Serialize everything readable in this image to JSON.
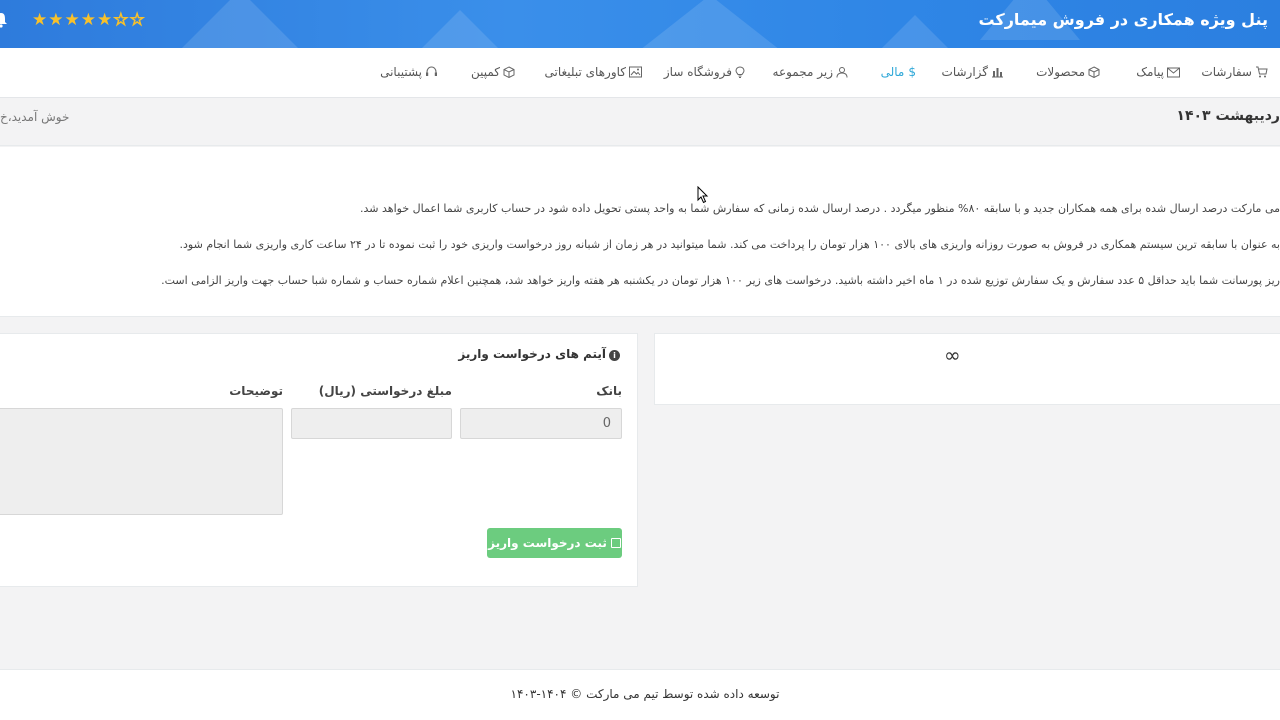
{
  "banner": {
    "title": "پنل ویژه همکاری در فروش میمارکت",
    "rating_filled": "★★★★★",
    "rating_empty": "☆☆"
  },
  "nav": {
    "items": [
      {
        "label": "سفارشات",
        "icon": "cart-icon"
      },
      {
        "label": "پیامک",
        "icon": "envelope-icon"
      },
      {
        "label": "محصولات",
        "icon": "box-icon"
      },
      {
        "label": "گزارشات",
        "icon": "bar-chart-icon"
      },
      {
        "label": "مالی",
        "icon": "dollar-icon"
      },
      {
        "label": "زیر مجموعه",
        "icon": "user-icon"
      },
      {
        "label": "فروشگاه ساز",
        "icon": "lightbulb-icon"
      },
      {
        "label": "کاورهای تبلیغاتی",
        "icon": "image-icon"
      },
      {
        "label": "کمپین",
        "icon": "box-icon"
      },
      {
        "label": "پشتیبانی",
        "icon": "headset-icon"
      }
    ],
    "active": "مالی"
  },
  "header": {
    "date": "ردیبهشت ۱۴۰۳",
    "welcome": "خوش آمدید،خ"
  },
  "notice": {
    "line1": "می مارکت درصد ارسال شده برای همه همکاران جدید و با سابقه ۸۰% منظور میگردد . درصد ارسال شده زمانی که سفارش شما به واحد پستی تحویل داده شود در حساب کاربری شما اعمال خواهد شد.",
    "line2": "به عنوان با سابقه ترین سیستم همکاری در فروش به صورت روزانه واریزی های بالای ۱۰۰ هزار تومان را پرداخت می کند. شما میتوانید در هر زمان از شبانه روز درخواست واریزی خود را ثبت نموده تا در ۲۴ ساعت کاری واریزی شما انجام شود.",
    "line3": "ریز پورسانت شما باید حداقل ۵ عدد سفارش و یک سفارش توزیع شده در ۱ ماه اخیر داشته باشید. درخواست های زیر ۱۰۰ هزار تومان در یکشنبه هر هفته واریز خواهد شد، همچنین اعلام شماره حساب و شماره شبا حساب جهت واریز الزامی است."
  },
  "balance_panel": {
    "value": "∞"
  },
  "form": {
    "title": "آیتم های درخواست واریز",
    "bank_label": "بانک",
    "bank_value": "0",
    "amount_label": "مبلغ درخواستی (ریال)",
    "amount_value": "",
    "desc_label": "توضیحات",
    "desc_value": "",
    "submit_label": "ثبت درخواست واریز"
  },
  "footer": {
    "text": "توسعه داده شده توسط تیم می مارکت © ۱۴۰۴-۱۴۰۳"
  },
  "colors": {
    "banner": "#2e7bdc",
    "active_nav": "#2fa8d8",
    "submit": "#6ccc7f",
    "star": "#f8c12b"
  }
}
